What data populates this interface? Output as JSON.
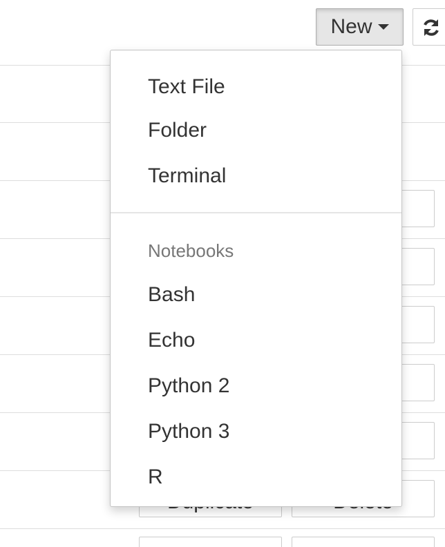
{
  "toolbar": {
    "new_label": "New",
    "refresh_icon": "refresh-icon"
  },
  "list_background": {
    "row_buttons": {
      "duplicate_label": "Duplicate",
      "delete_label": "Delete"
    }
  },
  "new_menu": {
    "items": [
      {
        "label": "Text File"
      },
      {
        "label": "Folder"
      },
      {
        "label": "Terminal"
      }
    ],
    "notebooks_header": "Notebooks",
    "notebooks": [
      {
        "label": "Bash"
      },
      {
        "label": "Echo"
      },
      {
        "label": "Python 2"
      },
      {
        "label": "Python 3"
      },
      {
        "label": "R"
      }
    ]
  },
  "colors": {
    "menu_text": "#333333",
    "header_text": "#777777",
    "new_button_bg": "#e6e6e6",
    "divider": "#e5e5e5"
  }
}
